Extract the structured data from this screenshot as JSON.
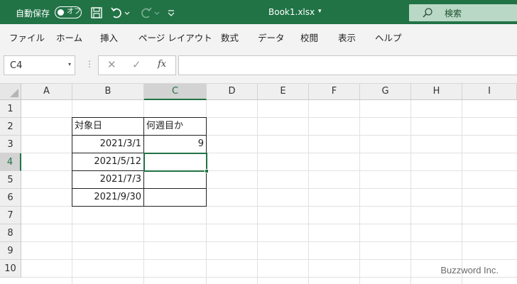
{
  "titlebar": {
    "autosave_label": "自動保存",
    "autosave_state": "オフ",
    "file_title": "Book1.xlsx",
    "title_caret": "▾",
    "search_placeholder": "検索",
    "bg_color": "#217346",
    "icons": [
      "save-icon",
      "undo-icon",
      "undo-dropdown-icon",
      "redo-icon",
      "redo-dropdown-icon",
      "customize-qat-icon",
      "search-icon"
    ]
  },
  "menu": {
    "items": [
      "ファイル",
      "ホーム",
      "挿入",
      "ページ レイアウト",
      "数式",
      "データ",
      "校閲",
      "表示",
      "ヘルプ"
    ]
  },
  "formula_bar": {
    "name_box": "C4",
    "name_box_caret": "▾",
    "dots": "⋮",
    "cancel_glyph": "✕",
    "enter_glyph": "✓",
    "fx_label": "fx",
    "formula": ""
  },
  "sheet": {
    "columns": [
      "A",
      "B",
      "C",
      "D",
      "E",
      "F",
      "G",
      "H",
      "I"
    ],
    "rows": [
      "1",
      "2",
      "3",
      "4",
      "5",
      "6",
      "7",
      "8",
      "9",
      "10"
    ],
    "active_cell": "C4",
    "accent_color": "#217346",
    "cells": {
      "B2": "対象日",
      "C2": "何週目か",
      "B3": "2021/3/1",
      "C3": "9",
      "B4": "2021/5/12",
      "B5": "2021/7/3",
      "B6": "2021/9/30"
    }
  },
  "watermark": "Buzzword Inc."
}
